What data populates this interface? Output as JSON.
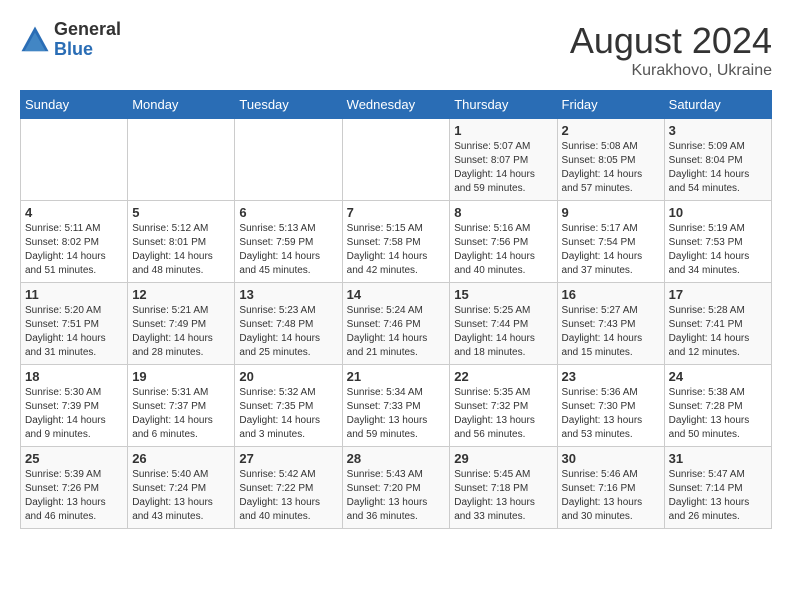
{
  "logo": {
    "general": "General",
    "blue": "Blue"
  },
  "title": {
    "month_year": "August 2024",
    "location": "Kurakhovo, Ukraine"
  },
  "days_of_week": [
    "Sunday",
    "Monday",
    "Tuesday",
    "Wednesday",
    "Thursday",
    "Friday",
    "Saturday"
  ],
  "weeks": [
    [
      {
        "day": "",
        "info": ""
      },
      {
        "day": "",
        "info": ""
      },
      {
        "day": "",
        "info": ""
      },
      {
        "day": "",
        "info": ""
      },
      {
        "day": "1",
        "info": "Sunrise: 5:07 AM\nSunset: 8:07 PM\nDaylight: 14 hours\nand 59 minutes."
      },
      {
        "day": "2",
        "info": "Sunrise: 5:08 AM\nSunset: 8:05 PM\nDaylight: 14 hours\nand 57 minutes."
      },
      {
        "day": "3",
        "info": "Sunrise: 5:09 AM\nSunset: 8:04 PM\nDaylight: 14 hours\nand 54 minutes."
      }
    ],
    [
      {
        "day": "4",
        "info": "Sunrise: 5:11 AM\nSunset: 8:02 PM\nDaylight: 14 hours\nand 51 minutes."
      },
      {
        "day": "5",
        "info": "Sunrise: 5:12 AM\nSunset: 8:01 PM\nDaylight: 14 hours\nand 48 minutes."
      },
      {
        "day": "6",
        "info": "Sunrise: 5:13 AM\nSunset: 7:59 PM\nDaylight: 14 hours\nand 45 minutes."
      },
      {
        "day": "7",
        "info": "Sunrise: 5:15 AM\nSunset: 7:58 PM\nDaylight: 14 hours\nand 42 minutes."
      },
      {
        "day": "8",
        "info": "Sunrise: 5:16 AM\nSunset: 7:56 PM\nDaylight: 14 hours\nand 40 minutes."
      },
      {
        "day": "9",
        "info": "Sunrise: 5:17 AM\nSunset: 7:54 PM\nDaylight: 14 hours\nand 37 minutes."
      },
      {
        "day": "10",
        "info": "Sunrise: 5:19 AM\nSunset: 7:53 PM\nDaylight: 14 hours\nand 34 minutes."
      }
    ],
    [
      {
        "day": "11",
        "info": "Sunrise: 5:20 AM\nSunset: 7:51 PM\nDaylight: 14 hours\nand 31 minutes."
      },
      {
        "day": "12",
        "info": "Sunrise: 5:21 AM\nSunset: 7:49 PM\nDaylight: 14 hours\nand 28 minutes."
      },
      {
        "day": "13",
        "info": "Sunrise: 5:23 AM\nSunset: 7:48 PM\nDaylight: 14 hours\nand 25 minutes."
      },
      {
        "day": "14",
        "info": "Sunrise: 5:24 AM\nSunset: 7:46 PM\nDaylight: 14 hours\nand 21 minutes."
      },
      {
        "day": "15",
        "info": "Sunrise: 5:25 AM\nSunset: 7:44 PM\nDaylight: 14 hours\nand 18 minutes."
      },
      {
        "day": "16",
        "info": "Sunrise: 5:27 AM\nSunset: 7:43 PM\nDaylight: 14 hours\nand 15 minutes."
      },
      {
        "day": "17",
        "info": "Sunrise: 5:28 AM\nSunset: 7:41 PM\nDaylight: 14 hours\nand 12 minutes."
      }
    ],
    [
      {
        "day": "18",
        "info": "Sunrise: 5:30 AM\nSunset: 7:39 PM\nDaylight: 14 hours\nand 9 minutes."
      },
      {
        "day": "19",
        "info": "Sunrise: 5:31 AM\nSunset: 7:37 PM\nDaylight: 14 hours\nand 6 minutes."
      },
      {
        "day": "20",
        "info": "Sunrise: 5:32 AM\nSunset: 7:35 PM\nDaylight: 14 hours and 3 minutes."
      },
      {
        "day": "21",
        "info": "Sunrise: 5:34 AM\nSunset: 7:33 PM\nDaylight: 13 hours\nand 59 minutes."
      },
      {
        "day": "22",
        "info": "Sunrise: 5:35 AM\nSunset: 7:32 PM\nDaylight: 13 hours\nand 56 minutes."
      },
      {
        "day": "23",
        "info": "Sunrise: 5:36 AM\nSunset: 7:30 PM\nDaylight: 13 hours\nand 53 minutes."
      },
      {
        "day": "24",
        "info": "Sunrise: 5:38 AM\nSunset: 7:28 PM\nDaylight: 13 hours\nand 50 minutes."
      }
    ],
    [
      {
        "day": "25",
        "info": "Sunrise: 5:39 AM\nSunset: 7:26 PM\nDaylight: 13 hours\nand 46 minutes."
      },
      {
        "day": "26",
        "info": "Sunrise: 5:40 AM\nSunset: 7:24 PM\nDaylight: 13 hours\nand 43 minutes."
      },
      {
        "day": "27",
        "info": "Sunrise: 5:42 AM\nSunset: 7:22 PM\nDaylight: 13 hours\nand 40 minutes."
      },
      {
        "day": "28",
        "info": "Sunrise: 5:43 AM\nSunset: 7:20 PM\nDaylight: 13 hours\nand 36 minutes."
      },
      {
        "day": "29",
        "info": "Sunrise: 5:45 AM\nSunset: 7:18 PM\nDaylight: 13 hours\nand 33 minutes."
      },
      {
        "day": "30",
        "info": "Sunrise: 5:46 AM\nSunset: 7:16 PM\nDaylight: 13 hours\nand 30 minutes."
      },
      {
        "day": "31",
        "info": "Sunrise: 5:47 AM\nSunset: 7:14 PM\nDaylight: 13 hours\nand 26 minutes."
      }
    ]
  ]
}
